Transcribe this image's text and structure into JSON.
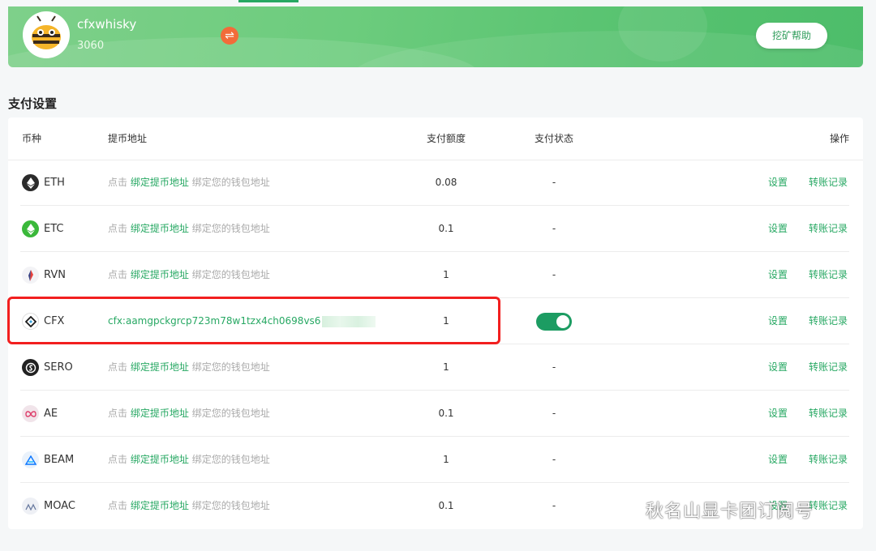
{
  "header": {
    "username": "cfxwhisky",
    "uid": "3060",
    "swap_icon": "⇌",
    "help_button": "挖矿帮助"
  },
  "section_title": "支付设置",
  "table": {
    "columns": {
      "coin": "币种",
      "address": "提币地址",
      "amount": "支付额度",
      "status": "支付状态",
      "ops": "操作"
    },
    "placeholder_prefix": "点击",
    "placeholder_link": "绑定提币地址",
    "placeholder_suffix": "绑定您的钱包地址",
    "settings_label": "设置",
    "log_label": "转账记录",
    "rows": [
      {
        "coin": "ETH",
        "amount": "0.08",
        "status": "-"
      },
      {
        "coin": "ETC",
        "amount": "0.1",
        "status": "-"
      },
      {
        "coin": "RVN",
        "amount": "1",
        "status": "-"
      },
      {
        "coin": "CFX",
        "address": "cfx:aamgpckgrcp723m78w1tzx4ch0698vs6",
        "amount": "1",
        "status_toggle": true
      },
      {
        "coin": "SERO",
        "amount": "1",
        "status": "-"
      },
      {
        "coin": "AE",
        "amount": "0.1",
        "status": "-"
      },
      {
        "coin": "BEAM",
        "amount": "1",
        "status": "-"
      },
      {
        "coin": "MOAC",
        "amount": "0.1",
        "status": "-"
      }
    ]
  },
  "watermark": "秋名山显卡团订阅号",
  "colors": {
    "accent": "#27a863",
    "highlight": "#f21f1f",
    "toggle": "#1c9c62"
  }
}
